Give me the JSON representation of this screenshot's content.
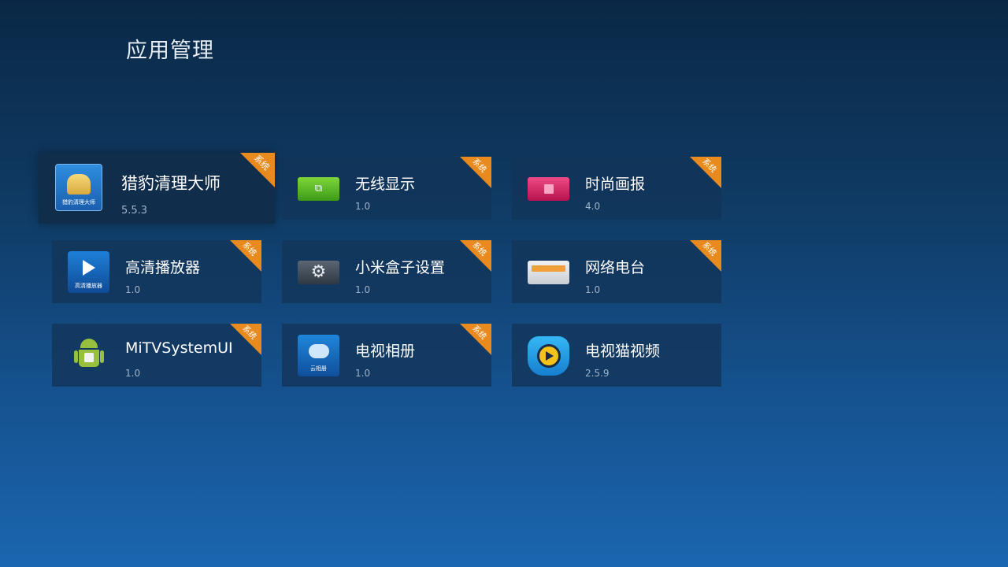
{
  "page": {
    "title": "应用管理"
  },
  "badge_text": "系统",
  "colors": {
    "badge": "#e98a1f",
    "card_bg": "#123458",
    "accent_text": "#9fb3c8"
  },
  "apps": [
    {
      "name": "猎豹清理大师",
      "version": "5.5.3",
      "icon": "broom-cleaner-icon",
      "icon_label": "猎豹清理大师",
      "system": true,
      "focused": true
    },
    {
      "name": "无线显示",
      "version": "1.0",
      "icon": "wireless-display-icon",
      "icon_glyph": "⧉",
      "system": true
    },
    {
      "name": "时尚画报",
      "version": "4.0",
      "icon": "fashion-gallery-icon",
      "system": true
    },
    {
      "name": "高清播放器",
      "version": "1.0",
      "icon": "hd-player-icon",
      "icon_label": "高清播放器",
      "system": true
    },
    {
      "name": "小米盒子设置",
      "version": "1.0",
      "icon": "settings-gear-icon",
      "icon_glyph": "⚙",
      "system": true
    },
    {
      "name": "网络电台",
      "version": "1.0",
      "icon": "radio-icon",
      "system": true
    },
    {
      "name": "MiTVSystemUI",
      "version": "1.0",
      "icon": "android-icon",
      "system": true
    },
    {
      "name": "电视相册",
      "version": "1.0",
      "icon": "cloud-album-icon",
      "icon_label": "云相册",
      "system": true
    },
    {
      "name": "电视猫视频",
      "version": "2.5.9",
      "icon": "tv-cat-video-icon",
      "system": false
    }
  ]
}
